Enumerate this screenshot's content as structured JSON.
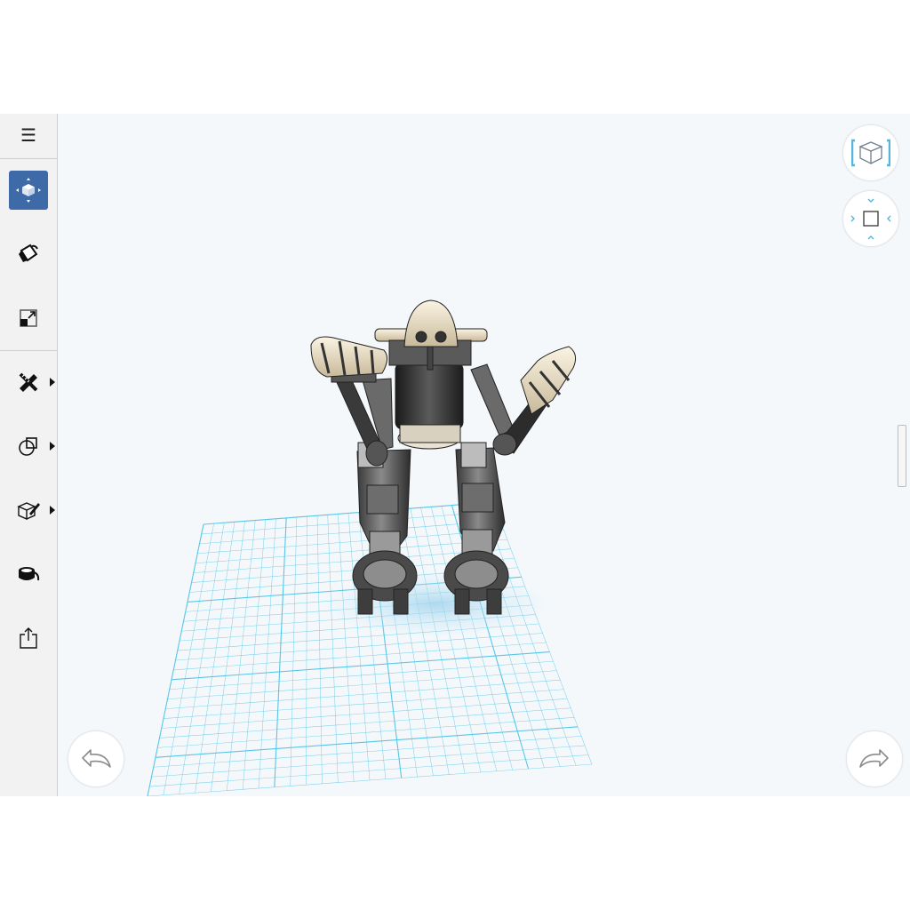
{
  "app": {
    "background": "#f4f8fb",
    "accent": "#3f6aa8",
    "grid_color": "#4fc3e6"
  },
  "sidebar": {
    "items": [
      {
        "id": "menu",
        "icon": "hamburger-menu-icon",
        "glyph": "☰",
        "active": false
      },
      {
        "id": "move",
        "icon": "move-transform-icon",
        "active": true
      },
      {
        "id": "material",
        "icon": "paint-bucket-icon",
        "active": false
      },
      {
        "id": "scale",
        "icon": "scale-icon",
        "active": false
      },
      {
        "id": "sketch",
        "icon": "pencil-ruler-icon",
        "submenu": true
      },
      {
        "id": "primitives",
        "icon": "shapes-icon",
        "submenu": true
      },
      {
        "id": "edit",
        "icon": "box-edit-icon",
        "submenu": true
      },
      {
        "id": "appearance",
        "icon": "paint-pot-icon",
        "active": false
      },
      {
        "id": "export",
        "icon": "share-export-icon",
        "active": false
      }
    ]
  },
  "view_controls": {
    "cube_icon": "view-cube-icon",
    "nav_icon": "ortho-view-nav-icon"
  },
  "history": {
    "undo_icon": "undo-icon",
    "redo_icon": "redo-icon"
  },
  "scene": {
    "model": "robot-model",
    "ground": "ground-grid"
  }
}
